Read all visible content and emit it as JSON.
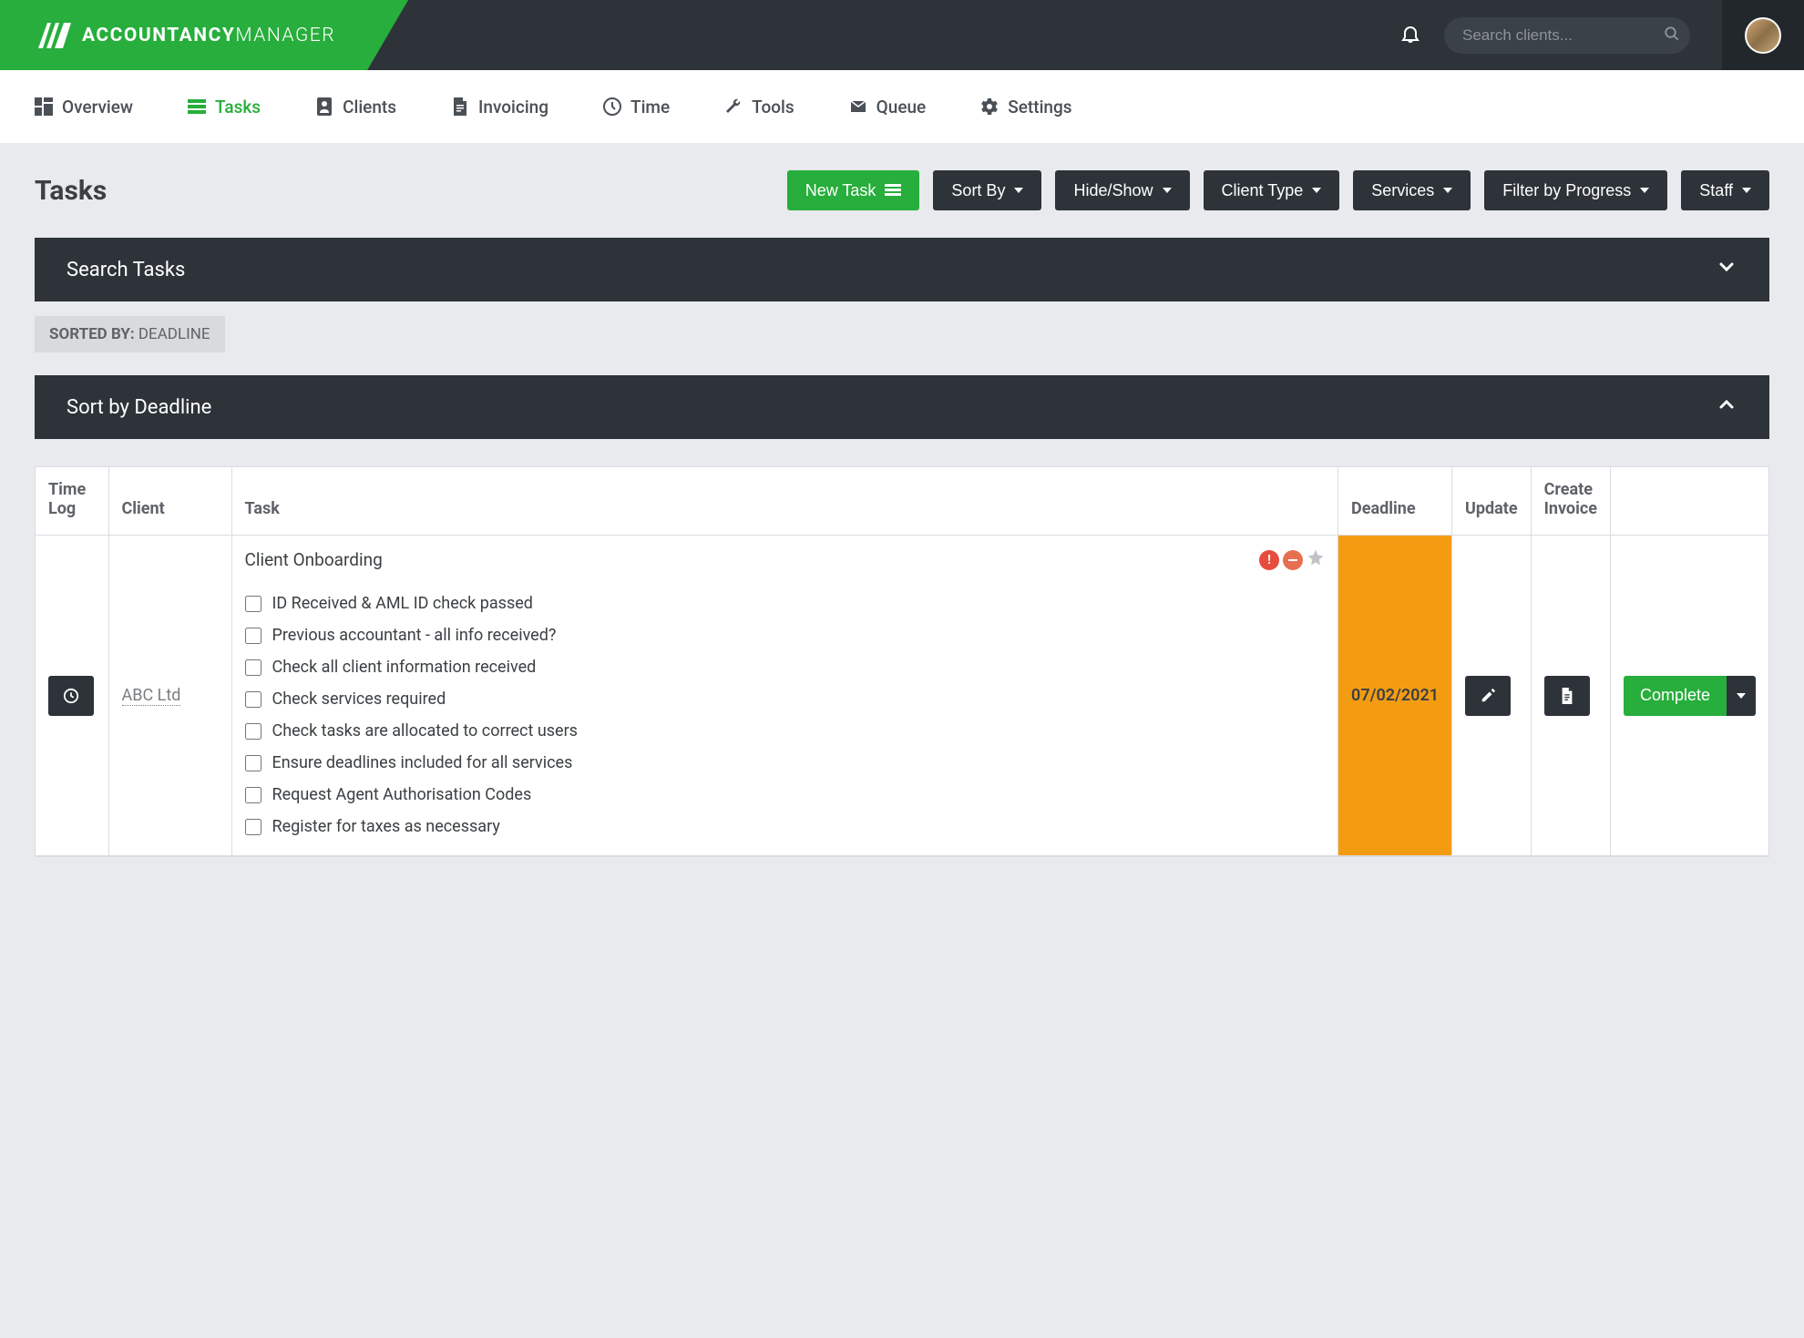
{
  "header": {
    "logo_bold": "ACCOUNTANCY",
    "logo_light": "MANAGER",
    "search_placeholder": "Search clients..."
  },
  "nav": {
    "overview": "Overview",
    "tasks": "Tasks",
    "clients": "Clients",
    "invoicing": "Invoicing",
    "time": "Time",
    "tools": "Tools",
    "queue": "Queue",
    "settings": "Settings"
  },
  "page": {
    "title": "Tasks",
    "new_task": "New Task",
    "sort_by": "Sort By",
    "hide_show": "Hide/Show",
    "client_type": "Client Type",
    "services": "Services",
    "filter_progress": "Filter by Progress",
    "staff": "Staff"
  },
  "search_tasks_panel": "Search Tasks",
  "sorted_by": {
    "label": "SORTED BY:",
    "value": " DEADLINE"
  },
  "sort_panel": "Sort by Deadline",
  "table": {
    "headers": {
      "timelog": "Time Log",
      "client": "Client",
      "task": "Task",
      "deadline": "Deadline",
      "update": "Update",
      "invoice": "Create Invoice"
    },
    "row": {
      "client": "ABC Ltd",
      "task_title": "Client Onboarding",
      "deadline": "07/02/2021",
      "complete": "Complete",
      "checklist": [
        "ID Received & AML ID check passed",
        "Previous accountant - all info received?",
        "Check all client information received",
        "Check services required",
        "Check tasks are allocated to correct users",
        "Ensure deadlines included for all services",
        "Request Agent Authorisation Codes",
        "Register for taxes as necessary"
      ]
    }
  }
}
